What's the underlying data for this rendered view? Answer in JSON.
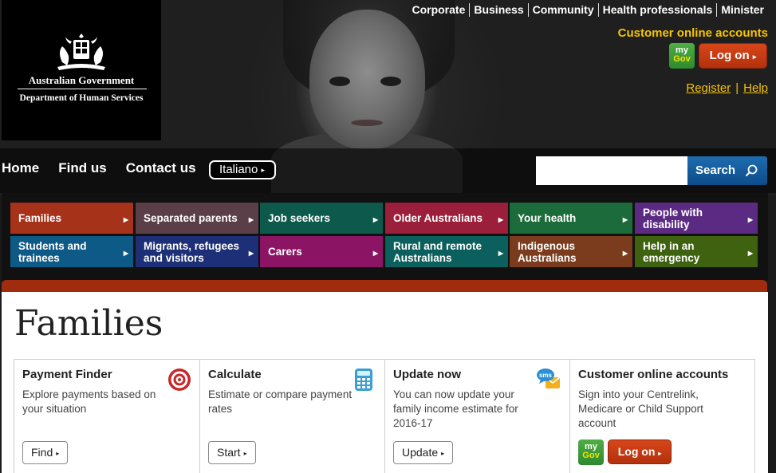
{
  "header": {
    "gov_name": "Australian Government",
    "dept_name": "Department of Human Services",
    "top_links": [
      "Corporate",
      "Business",
      "Community",
      "Health professionals",
      "Minister"
    ],
    "customer_accounts_title": "Customer online accounts",
    "mygov_logo": [
      "my",
      "Gov"
    ],
    "logon_label": "Log on",
    "register_label": "Register",
    "separator": "|",
    "help_label": "Help"
  },
  "nav": {
    "home": "Home",
    "find_us": "Find us",
    "contact_us": "Contact us",
    "language": "Italiano",
    "search_label": "Search",
    "search_value": ""
  },
  "categories": [
    {
      "label": "Families",
      "color": "#a6321a"
    },
    {
      "label": "Separated parents",
      "color": "#5a3f49"
    },
    {
      "label": "Job seekers",
      "color": "#0d5a4d"
    },
    {
      "label": "Older Australians",
      "color": "#9b1f3b"
    },
    {
      "label": "Your health",
      "color": "#1c6b3a"
    },
    {
      "label": "People with disability",
      "color": "#5b2b83"
    },
    {
      "label": "Students and trainees",
      "color": "#0e5a87"
    },
    {
      "label": "Migrants, refugees and visitors",
      "color": "#1d2f76"
    },
    {
      "label": "Carers",
      "color": "#8c1464"
    },
    {
      "label": "Rural and remote Australians",
      "color": "#0b5f5d"
    },
    {
      "label": "Indigenous Australians",
      "color": "#7a3c1c"
    },
    {
      "label": "Help in an emergency",
      "color": "#3f6210"
    }
  ],
  "page": {
    "title": "Families"
  },
  "cards": [
    {
      "title": "Payment Finder",
      "text": "Explore payments based on your situation",
      "button": "Find",
      "icon": "target-icon"
    },
    {
      "title": "Calculate",
      "text": "Estimate or compare payment rates",
      "button": "Start",
      "icon": "calculator-icon"
    },
    {
      "title": "Update now",
      "text": "You can now update your family income estimate for 2016-17",
      "button": "Update",
      "icon": "sms-icon"
    },
    {
      "title": "Customer online accounts",
      "text": "Sign into your Centrelink, Medicare or Child Support account",
      "button": "Log on",
      "icon": "mygov-logo"
    }
  ]
}
